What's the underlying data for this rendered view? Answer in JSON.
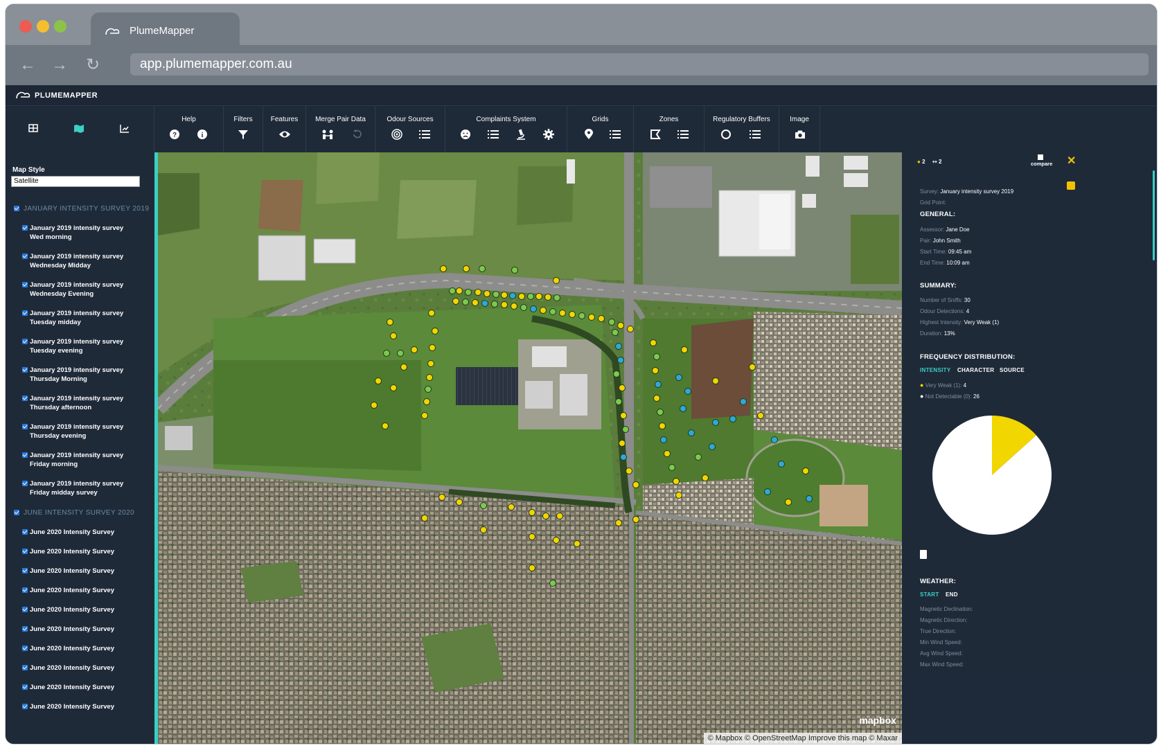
{
  "browser": {
    "tab_title": "PlumeMapper",
    "url": "app.plumemapper.com.au"
  },
  "app": {
    "brand": "PLUMEMAPPER"
  },
  "toolbar": {
    "groups": [
      {
        "label": "Help"
      },
      {
        "label": "Filters"
      },
      {
        "label": "Features"
      },
      {
        "label": "Merge Pair Data"
      },
      {
        "label": "Odour Sources"
      },
      {
        "label": "Complaints System"
      },
      {
        "label": "Grids"
      },
      {
        "label": "Zones"
      },
      {
        "label": "Regulatory Buffers"
      },
      {
        "label": "Image"
      }
    ]
  },
  "sidebar": {
    "map_style_label": "Map Style",
    "map_style_value": "Satellite",
    "sections": [
      {
        "title": "JANUARY INTENSITY SURVEY 2019",
        "items": [
          {
            "line1": "January 2019 intensity survey",
            "line2": "Wed morning"
          },
          {
            "line1": "January 2019 intensity survey",
            "line2": "Wednesday Midday"
          },
          {
            "line1": "January 2019 intensity survey",
            "line2": "Wednesday Evening"
          },
          {
            "line1": "January 2019 intensity survey",
            "line2": "Tuesday midday"
          },
          {
            "line1": "January 2019 intensity survey",
            "line2": "Tuesday evening"
          },
          {
            "line1": "January 2019 intensity survey",
            "line2": "Thursday Morning"
          },
          {
            "line1": "January 2019 intensity survey",
            "line2": "Thursday afternoon"
          },
          {
            "line1": "January 2019 intensity survey",
            "line2": "Thursday evening"
          },
          {
            "line1": "January 2019 intensity survey",
            "line2": "Friday morning"
          },
          {
            "line1": "January 2019 intensity survey",
            "line2": "Friday midday survey"
          }
        ]
      },
      {
        "title": "JUNE INTENSITY SURVEY 2020",
        "items": [
          {
            "line1": "June 2020 Intensity Survey"
          },
          {
            "line1": "June 2020 Intensity Survey"
          },
          {
            "line1": "June 2020 Intensity Survey"
          },
          {
            "line1": "June 2020 Intensity Survey"
          },
          {
            "line1": "June 2020 Intensity Survey"
          },
          {
            "line1": "June 2020 Intensity Survey"
          },
          {
            "line1": "June 2020 Intensity Survey"
          },
          {
            "line1": "June 2020 Intensity Survey"
          },
          {
            "line1": "June 2020 Intensity Survey"
          },
          {
            "line1": "June 2020 Intensity Survey"
          }
        ]
      }
    ]
  },
  "panel": {
    "count_a": "2",
    "count_b": "2",
    "compare_label": "compare",
    "survey_label": "Survey:",
    "survey_value": "January intensity survey 2019",
    "grid_point_label": "Grid Point:",
    "general_heading": "GENERAL:",
    "assessor_label": "Assessor:",
    "assessor_value": "Jane Doe",
    "pair_label": "Pair:",
    "pair_value": "John Smith",
    "start_label": "Start Time:",
    "start_value": "09:45 am",
    "end_label": "End Time:",
    "end_value": "10:09 am",
    "summary_heading": "SUMMARY:",
    "sniffs_label": "Number of Sniffs:",
    "sniffs_value": "30",
    "detections_label": "Odour Detections:",
    "detections_value": "4",
    "highest_label": "Highest Intensity:",
    "highest_value": "Very Weak (1)",
    "duration_label": "Duration:",
    "duration_value": "13%",
    "freq_heading": "FREQUENCY DISTRIBUTION:",
    "freq_tabs": [
      "INTENSITY",
      "CHARACTER",
      "SOURCE"
    ],
    "legend": [
      {
        "label": "Very Weak (1):",
        "value": "4",
        "color": "#f2d600"
      },
      {
        "label": "Not Detectable (0):",
        "value": "26",
        "color": "#ffffff"
      }
    ],
    "weather_heading": "WEATHER:",
    "weather_tabs": [
      "START",
      "END"
    ],
    "weather_fields": [
      "Magnetic Declination:",
      "Magnetic Direction:",
      "True Direction:",
      "Min Wind Speed:",
      "Avg Wind Speed:",
      "Max Wind Speed:"
    ]
  },
  "chart_data": {
    "type": "pie",
    "categories": [
      "Very Weak (1)",
      "Not Detectable (0)"
    ],
    "values": [
      4,
      26
    ],
    "colors": [
      "#f2d600",
      "#ffffff"
    ]
  },
  "map": {
    "attribution": "© Mapbox © OpenStreetMap Improve this map © Maxar",
    "logo": "mapbox"
  }
}
